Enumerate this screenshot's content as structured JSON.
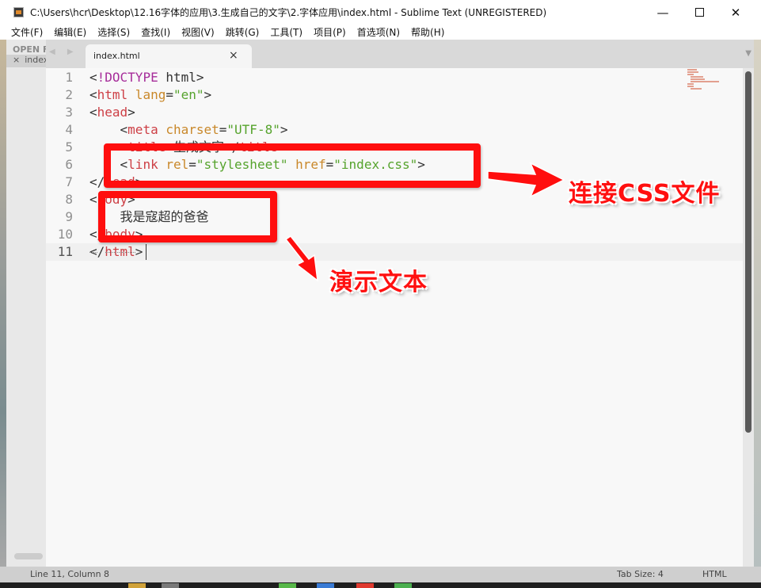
{
  "window": {
    "title": "C:\\Users\\hcr\\Desktop\\12.16字体的应用\\3.生成自己的文字\\2.字体应用\\index.html - Sublime Text (UNREGISTERED)",
    "minimize_glyph": "—",
    "close_glyph": "✕"
  },
  "menu": {
    "items": [
      {
        "label": "文件(F)"
      },
      {
        "label": "编辑(E)"
      },
      {
        "label": "选择(S)"
      },
      {
        "label": "查找(I)"
      },
      {
        "label": "视图(V)"
      },
      {
        "label": "跳转(G)"
      },
      {
        "label": "工具(T)"
      },
      {
        "label": "项目(P)"
      },
      {
        "label": "首选项(N)"
      },
      {
        "label": "帮助(H)"
      }
    ]
  },
  "sidebar": {
    "header": "OPEN FILES",
    "file": "index.html",
    "close_glyph": "×"
  },
  "tabs": {
    "nav_arrows": "◀ ▶",
    "active": {
      "label": "index.html",
      "close_glyph": "×"
    },
    "dropdown_glyph": "▼"
  },
  "editor": {
    "active_line": 11,
    "lines": [
      {
        "num": "1",
        "tokens": [
          [
            "br",
            "<"
          ],
          [
            "doctype",
            "!DOCTYPE"
          ],
          [
            "plain",
            " html"
          ],
          [
            "br",
            ">"
          ]
        ]
      },
      {
        "num": "2",
        "tokens": [
          [
            "br",
            "<"
          ],
          [
            "tag",
            "html"
          ],
          [
            "attr",
            " lang"
          ],
          [
            "br",
            "="
          ],
          [
            "str",
            "\"en\""
          ],
          [
            "br",
            ">"
          ]
        ]
      },
      {
        "num": "3",
        "tokens": [
          [
            "br",
            "<"
          ],
          [
            "tag",
            "head"
          ],
          [
            "br",
            ">"
          ]
        ]
      },
      {
        "num": "4",
        "tokens": [
          [
            "plain",
            "    "
          ],
          [
            "br",
            "<"
          ],
          [
            "tag",
            "meta"
          ],
          [
            "attr",
            " charset"
          ],
          [
            "br",
            "="
          ],
          [
            "str",
            "\"UTF-8\""
          ],
          [
            "br",
            ">"
          ]
        ]
      },
      {
        "num": "5",
        "tokens": [
          [
            "plain",
            "    "
          ],
          [
            "br",
            "<"
          ],
          [
            "tag",
            "title"
          ],
          [
            "br",
            ">"
          ],
          [
            "plain",
            "生成文字"
          ],
          [
            "br",
            "</"
          ],
          [
            "tag",
            "title"
          ],
          [
            "br",
            ">"
          ]
        ]
      },
      {
        "num": "6",
        "tokens": [
          [
            "plain",
            "    "
          ],
          [
            "br",
            "<"
          ],
          [
            "tag",
            "link"
          ],
          [
            "attr",
            " rel"
          ],
          [
            "br",
            "="
          ],
          [
            "str",
            "\"stylesheet\""
          ],
          [
            "attr",
            " href"
          ],
          [
            "br",
            "="
          ],
          [
            "str",
            "\"index.css\""
          ],
          [
            "br",
            ">"
          ]
        ]
      },
      {
        "num": "7",
        "tokens": [
          [
            "br",
            "</"
          ],
          [
            "tag",
            "head"
          ],
          [
            "br",
            ">"
          ]
        ]
      },
      {
        "num": "8",
        "tokens": [
          [
            "br",
            "<"
          ],
          [
            "tag",
            "body"
          ],
          [
            "br",
            ">"
          ]
        ]
      },
      {
        "num": "9",
        "tokens": [
          [
            "plain",
            "    我是寇超的爸爸"
          ]
        ]
      },
      {
        "num": "10",
        "tokens": [
          [
            "br",
            "</"
          ],
          [
            "tag",
            "body"
          ],
          [
            "br",
            ">"
          ]
        ]
      },
      {
        "num": "11",
        "tokens": [
          [
            "br",
            "</"
          ],
          [
            "tag",
            "html"
          ],
          [
            "br",
            ">"
          ]
        ]
      }
    ]
  },
  "annotations": {
    "link_label": "连接CSS文件",
    "demo_label": "演示文本",
    "color": "#ff0e0e"
  },
  "status": {
    "position": "Line 11, Column 8",
    "tab_size": "Tab Size: 4",
    "syntax": "HTML"
  }
}
